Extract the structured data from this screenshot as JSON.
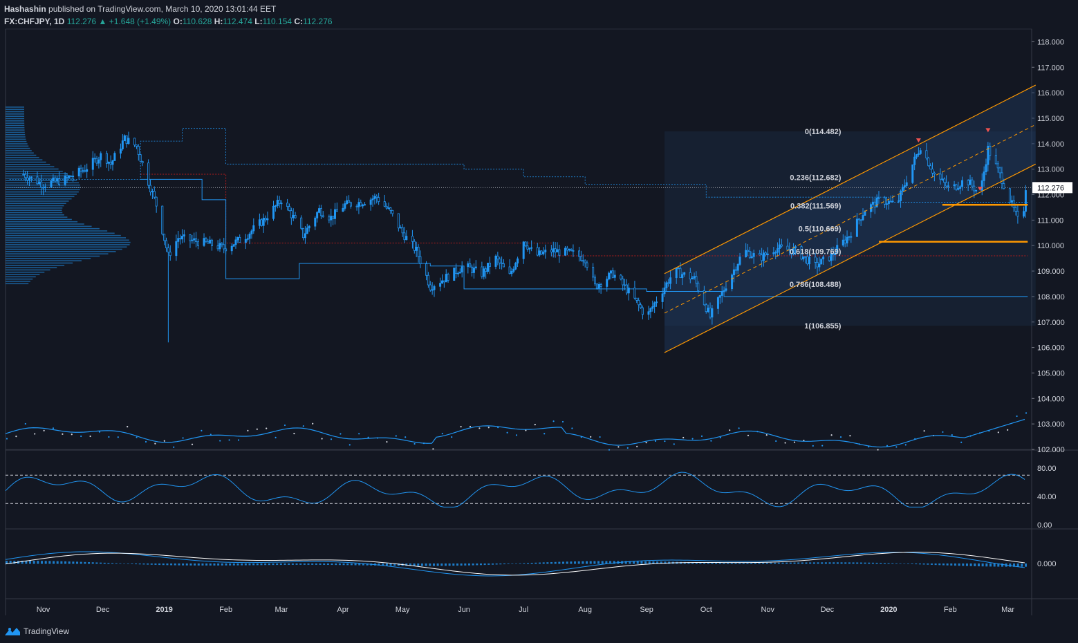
{
  "header": {
    "author": "Hashashin",
    "published_text": "published on TradingView.com, March 10, 2020 13:01:44 EET",
    "symbol": "FX:CHFJPY, 1D",
    "last": "112.276",
    "change": "+1.648 (+1.49%)",
    "o_label": "O:",
    "o": "110.628",
    "h_label": "H:",
    "h": "112.474",
    "l_label": "L:",
    "l": "110.154",
    "c_label": "C:",
    "c": "112.276"
  },
  "footer": {
    "brand": "TradingView"
  },
  "colors": {
    "background": "#131722",
    "candle": "#2196f3",
    "channel": "#ff9800",
    "fib_label": "#d1d4dc",
    "red_line": "#b71c1c",
    "grid": "#1e222d"
  },
  "chart_data": [
    {
      "type": "candlestick",
      "name": "price-pane",
      "ylim": [
        102.0,
        118.5
      ],
      "y_ticks": [
        "102.000",
        "103.000",
        "104.000",
        "105.000",
        "106.000",
        "107.000",
        "108.000",
        "109.000",
        "110.000",
        "111.000",
        "112.000",
        "113.000",
        "114.000",
        "115.000",
        "116.000",
        "117.000",
        "118.000"
      ],
      "last_price_label": "112.276",
      "x_ticks": [
        "Nov",
        "Dec",
        "2019",
        "Feb",
        "Mar",
        "Apr",
        "May",
        "Jun",
        "Jul",
        "Aug",
        "Sep",
        "Oct",
        "Nov",
        "Dec",
        "2020",
        "Feb",
        "Mar"
      ],
      "close_path": [
        [
          "2018-10-22",
          112.8
        ],
        [
          "2018-11-01",
          112.4
        ],
        [
          "2018-11-12",
          112.6
        ],
        [
          "2018-11-22",
          113.0
        ],
        [
          "2018-12-01",
          113.6
        ],
        [
          "2018-12-05",
          113.2
        ],
        [
          "2018-12-12",
          114.2
        ],
        [
          "2018-12-18",
          113.9
        ],
        [
          "2018-12-24",
          112.5
        ],
        [
          "2018-12-28",
          111.6
        ],
        [
          "2019-01-03",
          109.6
        ],
        [
          "2019-01-08",
          110.3
        ],
        [
          "2019-01-15",
          110.2
        ],
        [
          "2019-01-22",
          110.1
        ],
        [
          "2019-01-31",
          109.9
        ],
        [
          "2019-02-10",
          110.3
        ],
        [
          "2019-02-20",
          111.0
        ],
        [
          "2019-03-01",
          111.8
        ],
        [
          "2019-03-07",
          111.1
        ],
        [
          "2019-03-12",
          110.4
        ],
        [
          "2019-03-20",
          111.4
        ],
        [
          "2019-03-26",
          111.1
        ],
        [
          "2019-04-02",
          111.6
        ],
        [
          "2019-04-10",
          111.7
        ],
        [
          "2019-04-18",
          111.9
        ],
        [
          "2019-04-25",
          111.3
        ],
        [
          "2019-05-01",
          110.5
        ],
        [
          "2019-05-08",
          109.8
        ],
        [
          "2019-05-15",
          108.4
        ],
        [
          "2019-05-22",
          108.7
        ],
        [
          "2019-06-01",
          109.2
        ],
        [
          "2019-06-10",
          108.9
        ],
        [
          "2019-06-17",
          109.5
        ],
        [
          "2019-06-24",
          108.8
        ],
        [
          "2019-07-01",
          110.2
        ],
        [
          "2019-07-07",
          109.6
        ],
        [
          "2019-07-15",
          109.8
        ],
        [
          "2019-07-25",
          109.7
        ],
        [
          "2019-08-01",
          109.5
        ],
        [
          "2019-08-06",
          108.4
        ],
        [
          "2019-08-15",
          108.9
        ],
        [
          "2019-08-24",
          108.1
        ],
        [
          "2019-09-01",
          107.2
        ],
        [
          "2019-09-07",
          108.0
        ],
        [
          "2019-09-15",
          109.0
        ],
        [
          "2019-09-25",
          108.7
        ],
        [
          "2019-10-03",
          107.2
        ],
        [
          "2019-10-12",
          108.6
        ],
        [
          "2019-10-20",
          109.8
        ],
        [
          "2019-10-28",
          109.5
        ],
        [
          "2019-11-05",
          109.9
        ],
        [
          "2019-11-15",
          109.8
        ],
        [
          "2019-11-25",
          109.2
        ],
        [
          "2019-12-03",
          109.6
        ],
        [
          "2019-12-12",
          110.4
        ],
        [
          "2019-12-20",
          111.4
        ],
        [
          "2019-12-28",
          111.8
        ],
        [
          "2020-01-05",
          111.6
        ],
        [
          "2020-01-12",
          113.0
        ],
        [
          "2020-01-17",
          113.9
        ],
        [
          "2020-01-24",
          112.8
        ],
        [
          "2020-02-01",
          112.2
        ],
        [
          "2020-02-09",
          112.6
        ],
        [
          "2020-02-16",
          112.0
        ],
        [
          "2020-02-20",
          113.8
        ],
        [
          "2020-02-27",
          112.6
        ],
        [
          "2020-03-04",
          111.4
        ],
        [
          "2020-03-08",
          110.6
        ],
        [
          "2020-03-10",
          112.3
        ]
      ],
      "fibonacci": [
        {
          "label": "0(114.482)",
          "value": 114.482
        },
        {
          "label": "0.236(112.682)",
          "value": 112.682
        },
        {
          "label": "0.382(111.569)",
          "value": 111.569
        },
        {
          "label": "0.5(110.669)",
          "value": 110.669
        },
        {
          "label": "0.618(109.769)",
          "value": 109.769
        },
        {
          "label": "0.786(108.488)",
          "value": 108.488
        },
        {
          "label": "1(106.855)",
          "value": 106.855
        }
      ],
      "channel": {
        "start": [
          "2019-09-10",
          108.9
        ],
        "end": [
          "2020-03-15",
          116.3
        ],
        "lower_start": [
          "2019-09-10",
          105.8
        ],
        "lower_end": [
          "2020-03-15",
          113.2
        ]
      },
      "horizontal_levels": [
        {
          "value": 111.6,
          "from": "2020-01-28",
          "to": "2020-03-11"
        },
        {
          "value": 110.15,
          "from": "2019-12-27",
          "to": "2020-03-11"
        }
      ],
      "signal_markers": [
        [
          "2020-01-16",
          114.1
        ],
        [
          "2020-02-20",
          114.5
        ],
        [
          "2020-02-16",
          112.2
        ]
      ]
    },
    {
      "type": "line",
      "name": "volatility-subpane",
      "ylim": [
        102.0,
        106.0
      ],
      "description_series": "moving average with scattered dots"
    },
    {
      "type": "line",
      "name": "rsi-pane",
      "ylim": [
        0,
        100
      ],
      "y_ticks": [
        "80.00",
        "40.00",
        "0.00"
      ],
      "bands": [
        70,
        30
      ]
    },
    {
      "type": "bar",
      "name": "macd-pane",
      "y_ticks": [
        "0.000"
      ]
    }
  ]
}
